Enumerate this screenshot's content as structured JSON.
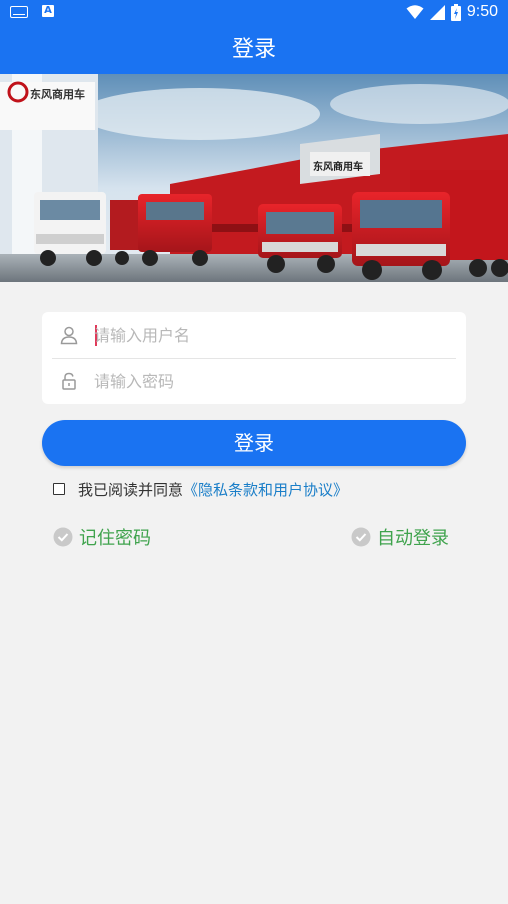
{
  "status_bar": {
    "time": "9:50",
    "icons": [
      "keyboard-icon",
      "a-notification-icon",
      "wifi-icon",
      "signal-icon",
      "battery-icon"
    ]
  },
  "header": {
    "title": "登录"
  },
  "banner": {
    "brand_text": "东风商用车"
  },
  "form": {
    "username_placeholder": "请输入用户名",
    "password_placeholder": "请输入密码",
    "username_value": "",
    "password_value": ""
  },
  "login_button": "登录",
  "agreement": {
    "text": "我已阅读并同意",
    "link": "《隐私条款和用户协议》",
    "checked": false
  },
  "options": {
    "remember_password": "记住密码",
    "auto_login": "自动登录"
  },
  "colors": {
    "primary": "#1a73f2",
    "background": "#f2f2f2",
    "option_green": "#3fa34d",
    "link_blue": "#1a7ec8",
    "caret_red": "#e03a5a"
  }
}
